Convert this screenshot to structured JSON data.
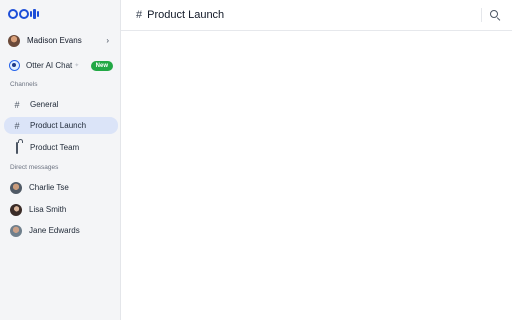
{
  "brand": {
    "logo_text": "Otter"
  },
  "user": {
    "name": "Madison Evans"
  },
  "otter_chat": {
    "label": "Otter AI Chat",
    "badge": "New"
  },
  "channels": {
    "heading": "Channels",
    "items": [
      {
        "label": "General",
        "icon": "hash-icon"
      },
      {
        "label": "Product Launch",
        "icon": "hash-icon",
        "active": true
      },
      {
        "label": "Product Team",
        "icon": "lock-icon"
      }
    ]
  },
  "direct_messages": {
    "heading": "Direct messages",
    "items": [
      {
        "label": "Charlie Tse"
      },
      {
        "label": "Lisa Smith"
      },
      {
        "label": "Jane Edwards"
      }
    ]
  },
  "header": {
    "hash": "#",
    "title": "Product Launch"
  },
  "colors": {
    "accent": "#1d4ed8",
    "active_bg": "#dbe4f8",
    "badge": "#22a845",
    "sidebar_bg": "#f4f5f7"
  }
}
